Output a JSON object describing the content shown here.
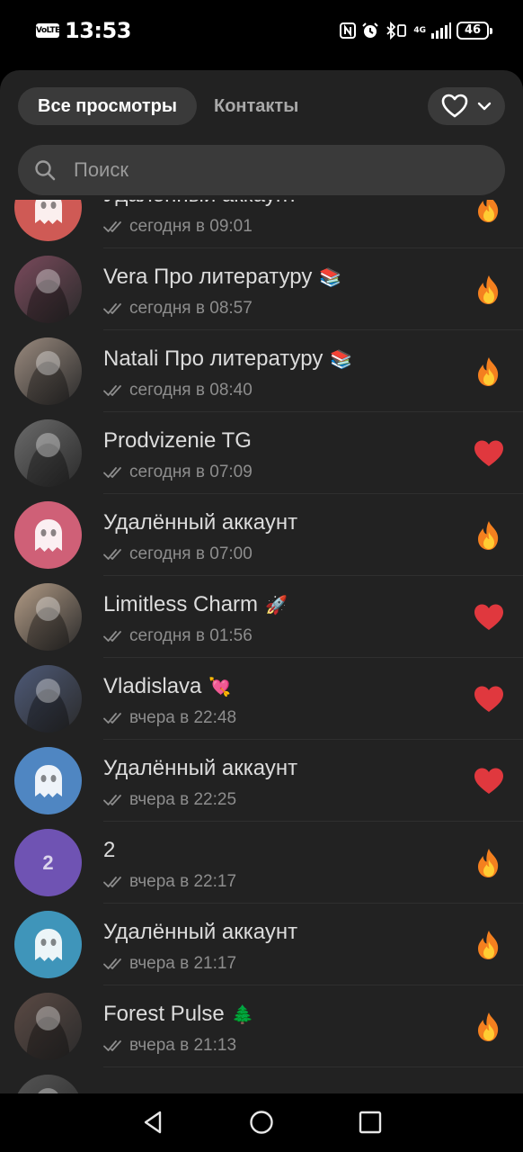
{
  "status_bar": {
    "volte": "VoLTE",
    "time": "13:53",
    "network": "4G",
    "battery": "46"
  },
  "tabs": [
    {
      "label": "Все просмотры",
      "active": true
    },
    {
      "label": "Контакты",
      "active": false
    }
  ],
  "reaction_filter": {
    "icon": "heart-outline-icon",
    "dropdown_icon": "chevron-down-icon"
  },
  "search": {
    "placeholder": "Поиск",
    "value": ""
  },
  "viewers": [
    {
      "name": "Удаленный аккаунт",
      "emoji": "",
      "seen": "сегодня в 09:01",
      "reaction": "fire",
      "avatar_type": "ghost",
      "avatar_color": "#cf5a55"
    },
    {
      "name": "Vera Про литературу",
      "emoji": "📚",
      "seen": "сегодня в 08:57",
      "reaction": "fire",
      "avatar_type": "photo",
      "avatar_color": "#7a4a5c"
    },
    {
      "name": "Natali Про литературу",
      "emoji": "📚",
      "seen": "сегодня в 08:40",
      "reaction": "fire",
      "avatar_type": "photo",
      "avatar_color": "#9a8a7e"
    },
    {
      "name": "Prodvizenie TG",
      "emoji": "",
      "seen": "сегодня в 07:09",
      "reaction": "heart",
      "avatar_type": "photo",
      "avatar_color": "#6b6b6b"
    },
    {
      "name": "Удалённый аккаунт",
      "emoji": "",
      "seen": "сегодня в 07:00",
      "reaction": "fire",
      "avatar_type": "ghost",
      "avatar_color": "#cf6077"
    },
    {
      "name": "Limitless Charm",
      "emoji": "🚀",
      "seen": "сегодня в 01:56",
      "reaction": "heart",
      "avatar_type": "photo",
      "avatar_color": "#b39c86"
    },
    {
      "name": "Vladislava",
      "emoji": "💘",
      "seen": "вчера в 22:48",
      "reaction": "heart",
      "avatar_type": "photo",
      "avatar_color": "#4e5a78"
    },
    {
      "name": "Удалённый аккаунт",
      "emoji": "",
      "seen": "вчера в 22:25",
      "reaction": "heart",
      "avatar_type": "ghost",
      "avatar_color": "#4f86c2"
    },
    {
      "name": "2",
      "emoji": "",
      "seen": "вчера в 22:17",
      "reaction": "fire",
      "avatar_type": "letter",
      "avatar_letter": "2",
      "avatar_color": "#6f53b3"
    },
    {
      "name": "Удалённый аккаунт",
      "emoji": "",
      "seen": "вчера в 21:17",
      "reaction": "fire",
      "avatar_type": "ghost",
      "avatar_color": "#3f95ba"
    },
    {
      "name": "Forest Pulse",
      "emoji": "🌲",
      "seen": "вчера в 21:13",
      "reaction": "fire",
      "avatar_type": "photo",
      "avatar_color": "#5b4a44"
    },
    {
      "name": "",
      "emoji": "",
      "seen": "",
      "reaction": "",
      "avatar_type": "photo",
      "avatar_color": "#555555"
    }
  ],
  "nav": {
    "back_icon": "back-triangle-icon",
    "home_icon": "home-circle-icon",
    "recents_icon": "recents-square-icon"
  }
}
